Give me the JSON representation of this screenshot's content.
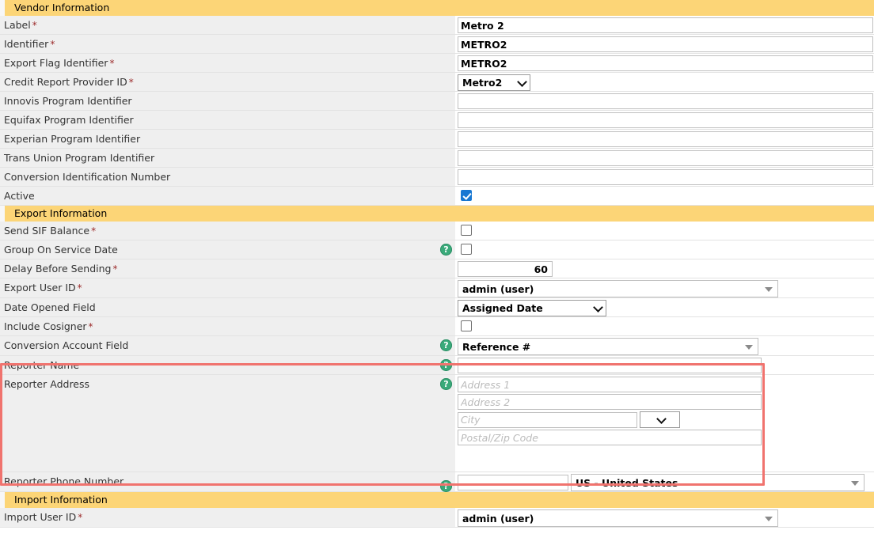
{
  "sections": {
    "vendor": {
      "title": "Vendor Information",
      "fields": {
        "label": {
          "label": "Label",
          "value": "Metro 2"
        },
        "identifier": {
          "label": "Identifier",
          "value": "METRO2"
        },
        "export_flag_identifier": {
          "label": "Export Flag Identifier",
          "value": "METRO2"
        },
        "credit_report_provider_id": {
          "label": "Credit Report Provider ID",
          "value": "Metro2"
        },
        "innovis_program_identifier": {
          "label": "Innovis Program Identifier",
          "value": ""
        },
        "equifax_program_identifier": {
          "label": "Equifax Program Identifier",
          "value": ""
        },
        "experian_program_identifier": {
          "label": "Experian Program Identifier",
          "value": ""
        },
        "trans_union_program_identifier": {
          "label": "Trans Union Program Identifier",
          "value": ""
        },
        "conversion_identification_number": {
          "label": "Conversion Identification Number",
          "value": ""
        },
        "active": {
          "label": "Active",
          "checked": true
        }
      }
    },
    "export": {
      "title": "Export Information",
      "fields": {
        "send_sif_balance": {
          "label": "Send SIF Balance",
          "checked": false
        },
        "group_on_service_date": {
          "label": "Group On Service Date",
          "checked": false
        },
        "delay_before_sending": {
          "label": "Delay Before Sending",
          "value": "60"
        },
        "export_user_id": {
          "label": "Export User ID",
          "value": "admin (user)"
        },
        "date_opened_field": {
          "label": "Date Opened Field",
          "value": "Assigned Date"
        },
        "include_cosigner": {
          "label": "Include Cosigner",
          "checked": false
        },
        "conversion_account_field": {
          "label": "Conversion Account Field",
          "value": "Reference #"
        },
        "reporter_name": {
          "label": "Reporter Name",
          "value": ""
        },
        "reporter_address": {
          "label": "Reporter Address",
          "address1_placeholder": "Address 1",
          "address2_placeholder": "Address 2",
          "city_placeholder": "City",
          "postal_placeholder": "Postal/Zip Code",
          "address1": "",
          "address2": "",
          "city": "",
          "postal": "",
          "state": ""
        },
        "reporter_phone_number": {
          "label": "Reporter Phone Number",
          "value": "",
          "country": "US - United States"
        }
      }
    },
    "import": {
      "title": "Import Information",
      "fields": {
        "import_user_id": {
          "label": "Import User ID",
          "value": "admin (user)"
        }
      }
    }
  },
  "icons": {
    "help": "?",
    "required_marker": "*"
  },
  "colors": {
    "section_header": "#fcd577",
    "row": "#efefef",
    "highlight": "#f0736e",
    "help_icon": "#3aaa7a",
    "checkbox_checked": "#1877d2",
    "required": "#9c2b2b"
  }
}
